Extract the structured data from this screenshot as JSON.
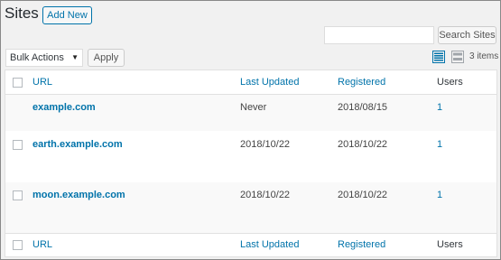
{
  "page": {
    "title": "Sites",
    "add_new_label": "Add New"
  },
  "search": {
    "value": "",
    "placeholder": "",
    "button_label": "Search Sites"
  },
  "bulk_actions": {
    "selected": "Bulk Actions",
    "apply_label": "Apply"
  },
  "view_modes": {
    "list_icon": "list-view-icon",
    "excerpt_icon": "excerpt-view-icon"
  },
  "item_count": "3 items",
  "table": {
    "columns": {
      "url": "URL",
      "last_updated": "Last Updated",
      "registered": "Registered",
      "users": "Users"
    },
    "rows": [
      {
        "url": "example.com",
        "last_updated": "Never",
        "registered": "2018/08/15",
        "users": "1",
        "has_checkbox": false
      },
      {
        "url": "earth.example.com",
        "last_updated": "2018/10/22",
        "registered": "2018/10/22",
        "users": "1",
        "has_checkbox": true
      },
      {
        "url": "moon.example.com",
        "last_updated": "2018/10/22",
        "registered": "2018/10/22",
        "users": "1",
        "has_checkbox": true
      }
    ]
  },
  "colors": {
    "link": "#0073aa",
    "background": "#f1f1f1",
    "table_bg": "#ffffff"
  }
}
